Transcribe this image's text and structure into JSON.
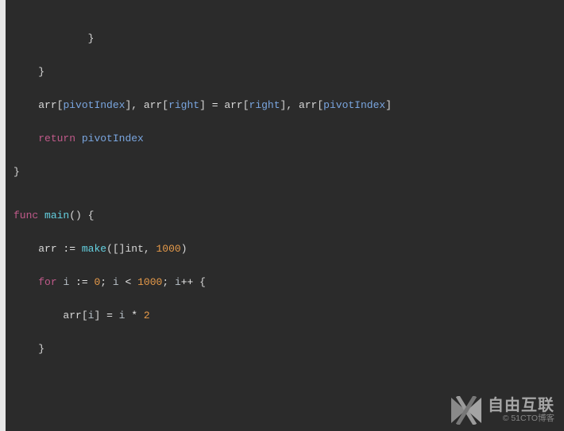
{
  "code": {
    "line1_brace": "}",
    "line2_brace": "}",
    "swap": {
      "arr1": "arr",
      "pivot1": "pivotIndex",
      "arr2": "arr",
      "right1": "right",
      "eq": " = ",
      "arr3": "arr",
      "right2": "right",
      "arr4": "arr",
      "pivot2": "pivotIndex"
    },
    "return_kw": "return",
    "return_val": "pivotIndex",
    "end_brace": "}",
    "func_kw": "func",
    "main_name": "main",
    "main_parens": "()",
    "main_open": " {",
    "make": {
      "arr": "arr",
      "decl": " := ",
      "make": "make",
      "open": "([]",
      "type": "int",
      "comma": ", ",
      "num": "1000",
      "close": ")"
    },
    "for": {
      "kw": "for",
      "space": " ",
      "i1": "i",
      "decl": " := ",
      "zero": "0",
      "semi1": "; ",
      "i2": "i",
      "lt": " < ",
      "limit": "1000",
      "semi2": "; ",
      "i3": "i",
      "pp": "++",
      "open": " {"
    },
    "body": {
      "arr": "arr",
      "open": "[",
      "i": "i",
      "close": "]",
      "eq": " = ",
      "i2": "i",
      "mul": " * ",
      "two": "2"
    },
    "for_close": "}"
  },
  "watermark": {
    "main": "自由互联",
    "sub": "© 51CTO博客"
  }
}
